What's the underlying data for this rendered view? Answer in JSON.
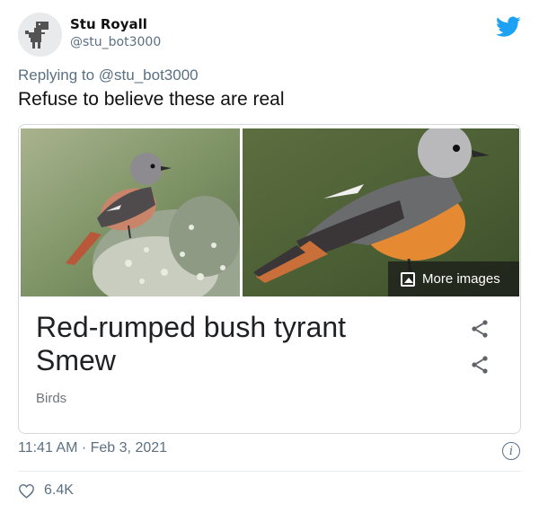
{
  "author": {
    "display_name": "Stu Royall",
    "handle": "@stu_bot3000"
  },
  "reply": {
    "prefix": "Replying to ",
    "mention": "@stu_bot3000"
  },
  "tweet_text": "Refuse to believe these are real",
  "card": {
    "title_line1": "Red-rumped bush tyrant",
    "title_line2": "Smew",
    "subtitle": "Birds",
    "more_images_label": "More images"
  },
  "footer": {
    "timestamp": "11:41 AM · Feb 3, 2021",
    "like_count": "6.4K"
  },
  "icons": {
    "brand": "twitter-bird-icon",
    "share": "share-icon",
    "info": "info-icon",
    "like": "heart-icon",
    "more_images": "image-icon"
  },
  "colors": {
    "twitter_blue": "#1da1f2",
    "secondary_text": "#5b7083",
    "card_border": "#d6d9db"
  }
}
